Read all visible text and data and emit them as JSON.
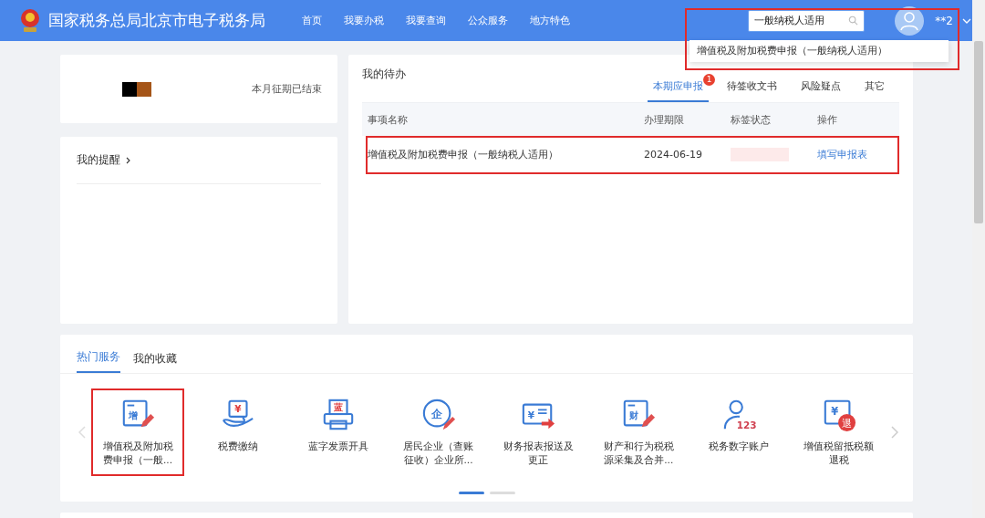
{
  "header": {
    "title": "国家税务总局北京市电子税务局",
    "nav": [
      {
        "label": "首页"
      },
      {
        "label": "我要办税"
      },
      {
        "label": "我要查询"
      },
      {
        "label": "公众服务"
      },
      {
        "label": "地方特色"
      }
    ],
    "search": {
      "value": "一般纳税人适用",
      "highlighted": true,
      "suggestions": [
        "增值税及附加税费申报（一般纳税人适用）"
      ]
    },
    "user": "**2"
  },
  "period_card": {
    "status": "本月征期已结束"
  },
  "reminders": {
    "title": "我的提醒"
  },
  "todo": {
    "title": "我的待办",
    "tabs": [
      {
        "label": "本期应申报",
        "selected": true,
        "badge": "1"
      },
      {
        "label": "待签收文书",
        "selected": false
      },
      {
        "label": "风险疑点",
        "selected": false
      },
      {
        "label": "其它",
        "selected": false
      }
    ],
    "columns": [
      "事项名称",
      "办理期限",
      "标签状态",
      "操作"
    ],
    "rows": [
      {
        "name": "增值税及附加税费申报（一般纳税人适用）",
        "deadline": "2024-06-19",
        "action": "填写申报表",
        "highlighted": true
      }
    ]
  },
  "services": {
    "tabs": [
      {
        "label": "热门服务",
        "selected": true
      },
      {
        "label": "我的收藏",
        "selected": false
      }
    ],
    "items": [
      {
        "kind": "doc-pencil",
        "glyph": "增",
        "label": "增值税及附加税费申报（一般...",
        "highlighted": true
      },
      {
        "kind": "hand",
        "glyph": "¥",
        "label": "税费缴纳",
        "highlighted": false
      },
      {
        "kind": "printer",
        "glyph": "蓝",
        "label": "蓝字发票开具",
        "highlighted": false
      },
      {
        "kind": "circle-pencil",
        "glyph": "企",
        "label": "居民企业（查账征收）企业所...",
        "highlighted": false
      },
      {
        "kind": "card-arrow",
        "glyph": "¥",
        "label": "财务报表报送及更正",
        "highlighted": false
      },
      {
        "kind": "doc-pencil",
        "glyph": "财",
        "label": "财产和行为税税源采集及合并...",
        "highlighted": false
      },
      {
        "kind": "person",
        "glyph": "123",
        "label": "税务数字账户",
        "highlighted": false
      },
      {
        "kind": "doc-badge",
        "glyph": "¥",
        "badge": "退",
        "label": "增值税留抵税额退税",
        "highlighted": false
      }
    ],
    "pages": [
      {
        "selected": true
      },
      {
        "selected": false
      }
    ]
  }
}
